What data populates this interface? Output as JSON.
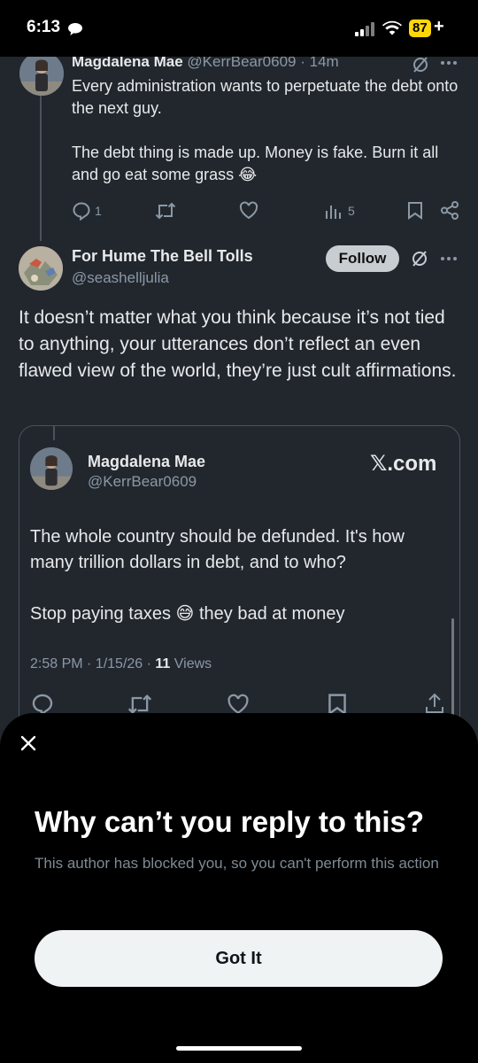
{
  "status_bar": {
    "time": "6:13",
    "battery": "87",
    "battery_plus": "+"
  },
  "thread": {
    "post1": {
      "author_name": "Magdalena Mae",
      "handle": "@KerrBear0609",
      "age": "· 14m",
      "paragraphs": [
        "Every administration wants to perpetuate the debt onto the next guy.",
        "The debt thing is made up. Money is fake. Burn it all and go eat some grass 😂"
      ],
      "actions": {
        "replies": "1",
        "views": "5"
      }
    },
    "post2": {
      "author_name": "For Hume The Bell Tolls",
      "handle": "@seashelljulia",
      "follow_label": "Follow",
      "body": "It doesn’t matter what you think because it’s not tied to anything, your utterances don’t reflect an even flawed view of the world, they’re just cult affirmations.",
      "quote": {
        "author_name": "Magdalena Mae",
        "handle": "@KerrBear0609",
        "site": "𝕏.com",
        "paragraphs": [
          "The whole country should be defunded. It's how many trillion dollars in debt, and to who?",
          "Stop paying taxes 😅 they bad at money"
        ],
        "timestamp": "2:58 PM · 1/15/26 · ",
        "views_count": "11",
        "views_label": " Views"
      }
    }
  },
  "sheet": {
    "title": "Why can’t you reply to this?",
    "description": "This author has blocked you, so you can't perform this action",
    "button_label": "Got It"
  },
  "colors": {
    "background": "#22272e",
    "sheet": "#000000",
    "muted_text": "#8b98a5",
    "battery": "#ffd60a"
  },
  "icons": [
    "chat-bubble-icon",
    "signal-icon",
    "wifi-icon",
    "grok-icon",
    "more-icon",
    "reply-icon",
    "retweet-icon",
    "like-icon",
    "views-icon",
    "bookmark-icon",
    "share-icon",
    "close-icon"
  ]
}
